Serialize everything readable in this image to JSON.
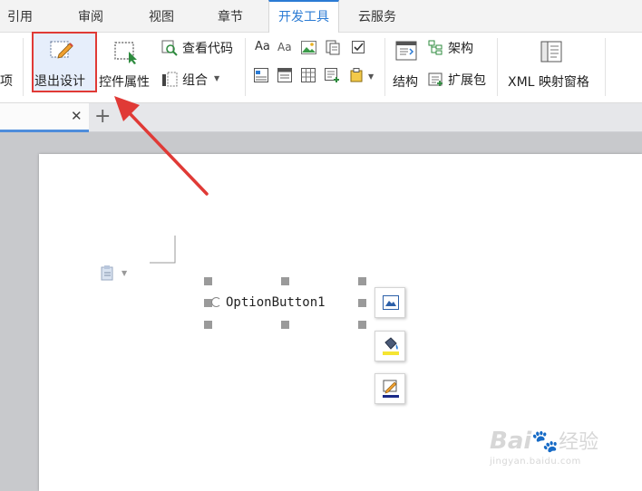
{
  "tabs": [
    {
      "label": "引用",
      "active": false
    },
    {
      "label": "审阅",
      "active": false
    },
    {
      "label": "视图",
      "active": false
    },
    {
      "label": "章节",
      "active": false
    },
    {
      "label": "开发工具",
      "active": true
    },
    {
      "label": "云服务",
      "active": false
    }
  ],
  "ribbon": {
    "cut_left_label": "项",
    "exit_design": "退出设计",
    "control_props": "控件属性",
    "view_code": "查看代码",
    "group": "组合",
    "structure": "结构",
    "schema": "架构",
    "expansion_pack": "扩展包",
    "xml_pane": "XML 映射窗格"
  },
  "document": {
    "option_label": "OptionButton1"
  },
  "watermark": {
    "brand": "Bai",
    "brand2": "经验",
    "url": "jingyan.baidu.com"
  },
  "colors": {
    "accent": "#2b7bd4",
    "highlight_border": "#e03a36",
    "arrow": "#e03a36"
  }
}
